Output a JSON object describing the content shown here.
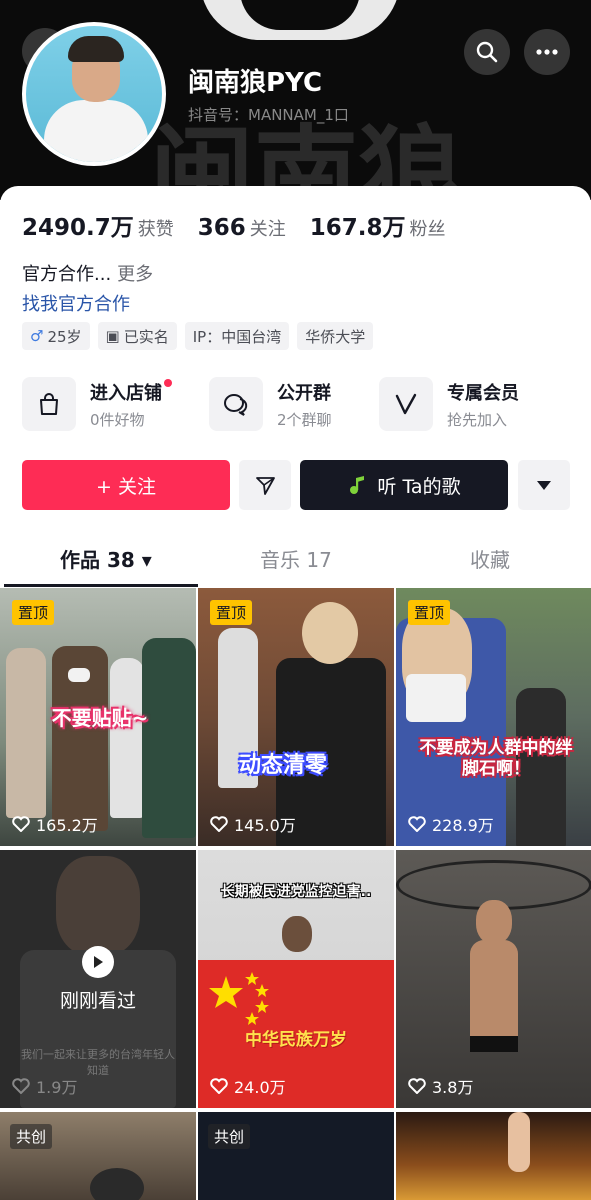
{
  "profile": {
    "name": "闽南狼PYC",
    "douyin_id": "抖音号：MANNAM_1口"
  },
  "stats": [
    {
      "value": "2490.7万",
      "label": "获赞"
    },
    {
      "value": "366",
      "label": "关注"
    },
    {
      "value": "167.8万",
      "label": "粉丝"
    }
  ],
  "bio": {
    "text": "官方合作...",
    "more": "更多",
    "link": "找我官方合作"
  },
  "tags": [
    {
      "icon": "male-icon",
      "glyph": "♂",
      "text": "25岁"
    },
    {
      "icon": "id-card-icon",
      "glyph": "▣",
      "text": "已实名"
    },
    {
      "icon": "",
      "glyph": "",
      "text": "IP：中国台湾"
    },
    {
      "icon": "",
      "glyph": "",
      "text": "华侨大学"
    }
  ],
  "services": [
    {
      "title": "进入店铺",
      "sub": "0件好物",
      "icon": "shopping-bag-icon"
    },
    {
      "title": "公开群",
      "sub": "2个群聊",
      "icon": "chat-group-icon"
    },
    {
      "title": "专属会员",
      "sub": "抢先加入",
      "icon": "vip-icon"
    }
  ],
  "actions": {
    "follow": "+ 关注",
    "music": "听 Ta的歌"
  },
  "tabs": [
    {
      "label": "作品 38 ▾"
    },
    {
      "label": "音乐 17"
    },
    {
      "label": "收藏"
    }
  ],
  "videos": [
    {
      "badge": "置顶",
      "caption": "不要贴贴~",
      "likes": "165.2万"
    },
    {
      "badge": "置顶",
      "caption": "动态清零",
      "likes": "145.0万"
    },
    {
      "badge": "置顶",
      "caption": "不要成为人群中的绊脚石啊！",
      "likes": "228.9万"
    },
    {
      "badge": "",
      "caption": "刚刚看过",
      "overlay": "我们一起来让更多的台湾年轻人知道",
      "likes": "1.9万"
    },
    {
      "badge": "",
      "caption_top": "长期被民进党监控迫害..",
      "caption": "中华民族万岁",
      "likes": "24.0万"
    },
    {
      "badge": "",
      "caption": "",
      "likes": "3.8万"
    },
    {
      "badge": "共创",
      "caption": "",
      "likes": ""
    },
    {
      "badge": "共创",
      "caption": "",
      "likes": ""
    },
    {
      "badge": "",
      "caption": "",
      "likes": ""
    }
  ],
  "colors": {
    "accent": "#fe2c55",
    "pin": "#ffc300",
    "link": "#2a55a8"
  }
}
